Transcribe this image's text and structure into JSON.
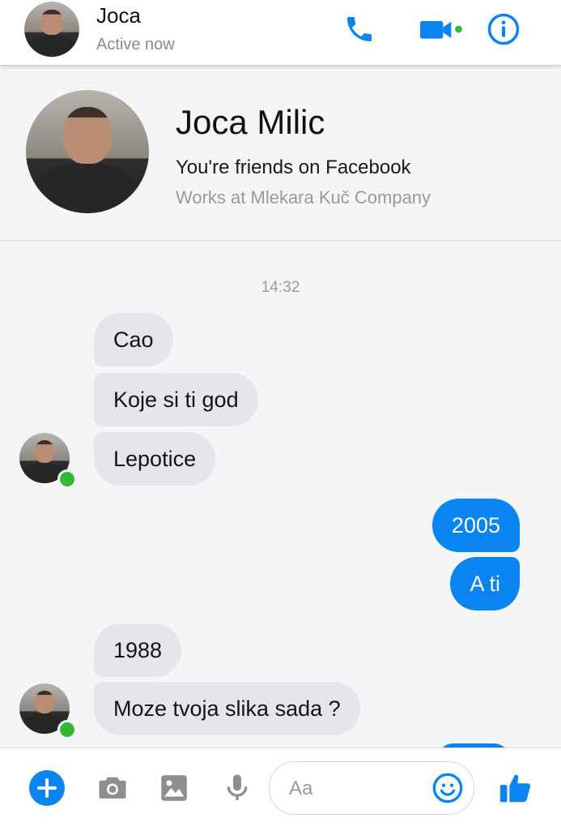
{
  "header": {
    "name": "Joca",
    "status": "Active now",
    "icons": [
      "phone-icon",
      "video-camera-icon",
      "info-icon"
    ]
  },
  "profile": {
    "name": "Joca Milic",
    "friends": "You're friends on Facebook",
    "work": "Works at Mlekara Kuč Company"
  },
  "timestamp": "14:32",
  "messages": [
    {
      "from": "them",
      "text": "Cao"
    },
    {
      "from": "them",
      "text": "Koje si ti god"
    },
    {
      "from": "them",
      "text": "Lepotice"
    },
    {
      "from": "me",
      "text": "2005"
    },
    {
      "from": "me",
      "text": "A ti"
    },
    {
      "from": "them",
      "text": "1988"
    },
    {
      "from": "them",
      "text": "Moze tvoja slika sada ?"
    }
  ],
  "composer": {
    "placeholder": "Aa",
    "icons": [
      "plus-icon",
      "camera-icon",
      "image-icon",
      "microphone-icon",
      "emoji-icon",
      "thumbs-up-icon"
    ]
  },
  "colors": {
    "accent": "#0a84f1",
    "incoming_bubble": "#e4e6eb",
    "online": "#31b936",
    "chat_background": "#f4f5f7"
  }
}
